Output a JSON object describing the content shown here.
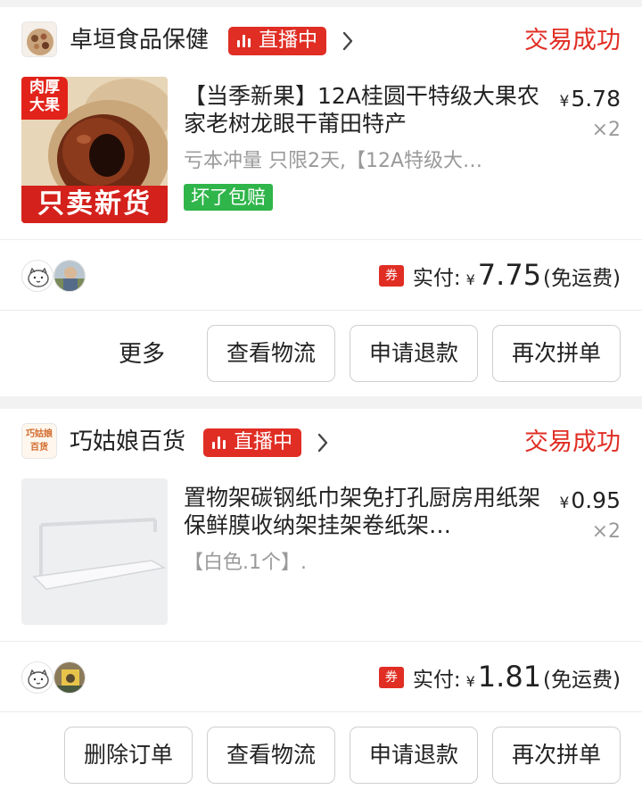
{
  "orders": [
    {
      "store": {
        "name": "卓垣食品保健",
        "live_label": "直播中"
      },
      "status": "交易成功",
      "product": {
        "title": "【当季新果】12A桂圆干特级大果农家老树龙眼干莆田特产",
        "spec": "亏本冲量 只限2天,【12A特级大…",
        "tag": "坏了包赔",
        "thumb_top_label": "肉厚\n大果",
        "thumb_bottom_label": "只卖新货",
        "price_symbol": "¥",
        "price": "5.78",
        "quantity": "×2"
      },
      "paid": {
        "coupon": "券",
        "label": "实付:",
        "symbol": "¥",
        "amount": "7.75",
        "note": "(免运费)"
      },
      "actions": {
        "more": "更多",
        "buttons": [
          "查看物流",
          "申请退款",
          "再次拼单"
        ]
      }
    },
    {
      "store": {
        "name": "巧姑娘百货",
        "live_label": "直播中",
        "logo_text": "巧姑娘\n百货"
      },
      "status": "交易成功",
      "product": {
        "title": "置物架碳钢纸巾架免打孔厨房用纸架保鲜膜收纳架挂架卷纸架…",
        "spec": "【白色.1个】.",
        "price_symbol": "¥",
        "price": "0.95",
        "quantity": "×2"
      },
      "paid": {
        "coupon": "券",
        "label": "实付:",
        "symbol": "¥",
        "amount": "1.81",
        "note": "(免运费)"
      },
      "actions": {
        "buttons": [
          "删除订单",
          "查看物流",
          "申请退款",
          "再次拼单"
        ]
      }
    }
  ],
  "colors": {
    "accent": "#e02e24",
    "green_tag": "#2fb54a",
    "muted_text": "#9a9a9a"
  }
}
